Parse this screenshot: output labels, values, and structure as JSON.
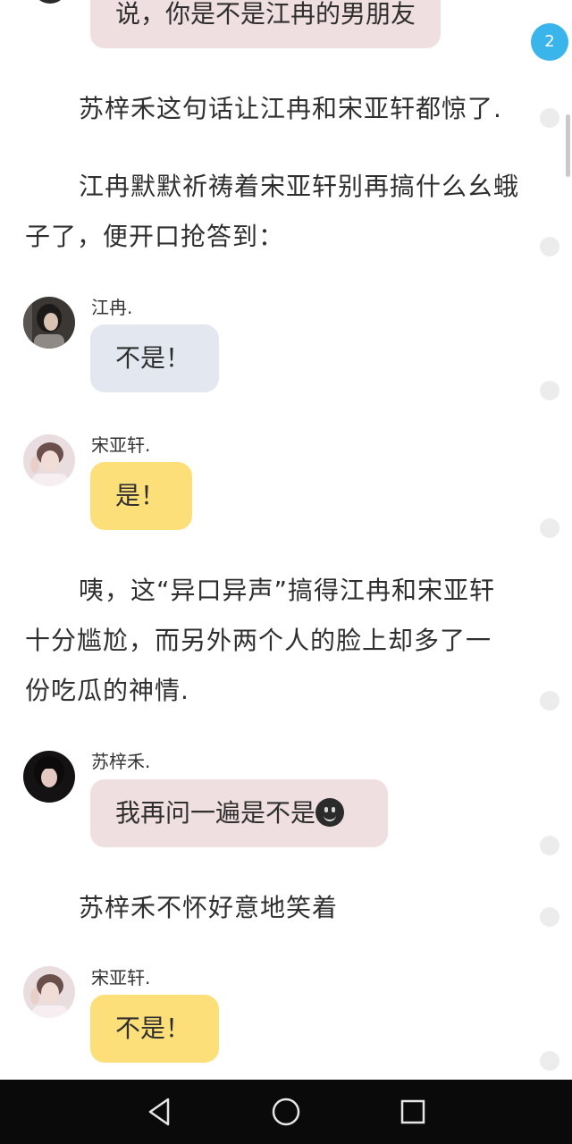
{
  "badge": {
    "count": "2"
  },
  "blocks": {
    "top_bubble": {
      "text": "说，你是不是江冉的男朋友"
    },
    "para1": {
      "text": "苏梓禾这句话让江冉和宋亚轩都惊了."
    },
    "para2": {
      "text": "江冉默默祈祷着宋亚轩别再搞什么幺蛾子了，便开口抢答到："
    },
    "msg1": {
      "name": "江冉.",
      "text": "不是！"
    },
    "msg2": {
      "name": "宋亚轩.",
      "text": "是！"
    },
    "para3": {
      "text": "咦，这“异口异声”搞得江冉和宋亚轩十分尴尬，而另外两个人的脸上却多了一份吃瓜的神情."
    },
    "msg3": {
      "name": "苏梓禾.",
      "text": "我再问一遍是不是"
    },
    "para4": {
      "text": "苏梓禾不怀好意地笑着"
    },
    "msg4": {
      "name": "宋亚轩.",
      "text": "不是！"
    }
  },
  "icons": {
    "back": "back-triangle-icon",
    "home": "home-circle-icon",
    "recents": "recents-square-icon",
    "emoji": "smiley-face-emoji-icon"
  },
  "colors": {
    "bubble_pink": "#f0dfe0",
    "bubble_blue": "#e3e8f0",
    "bubble_yellow": "#fddf7a",
    "badge": "#39b5ec",
    "navbar": "#0a0a0a"
  }
}
